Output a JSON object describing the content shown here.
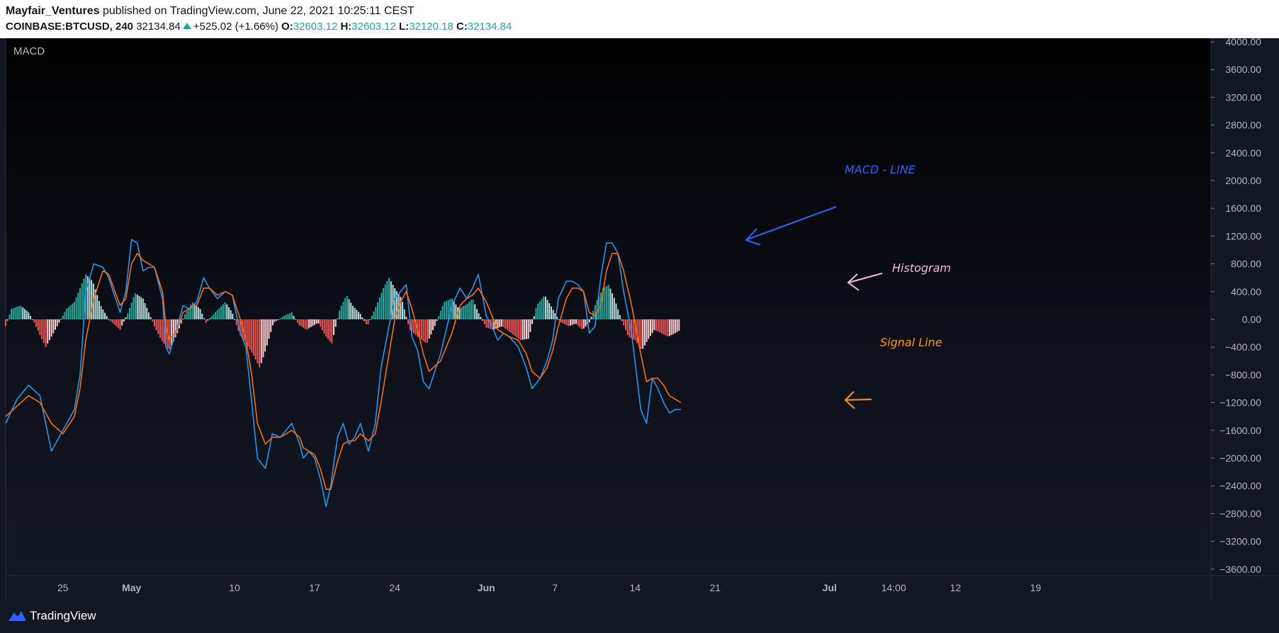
{
  "header": {
    "author": "Mayfair_Ventures",
    "published_text": " published on TradingView.com, June 22, 2021 10:25:11 CEST",
    "symbol": "COINBASE:BTCUSD, 240",
    "last": "32134.84",
    "change": "+525.02 (+1.66%)",
    "o_label": "O:",
    "o_value": "32603.12",
    "h_label": "H:",
    "h_value": "32603.12",
    "l_label": "L:",
    "l_value": "32120.18",
    "c_label": "C:",
    "c_value": "32134.84"
  },
  "footer": {
    "brand": "TradingView"
  },
  "colors": {
    "background": "#131722",
    "macd_line": "#2196f3",
    "signal_line": "#ff6d00",
    "hist_up_strong": "#26a69a",
    "hist_up_weak": "#b2dfdb",
    "hist_down_strong": "#ef5350",
    "hist_down_weak": "#ffcdd2",
    "annotation_macd": "#2962ff",
    "annotation_histogram": "#f8bbd0",
    "annotation_signal": "#ff9800"
  },
  "chart_data": {
    "type": "line",
    "title": "MACD",
    "ylim": [
      -3600,
      4000
    ],
    "y_ticks": [
      4000,
      3600,
      3200,
      2800,
      2400,
      2000,
      1600,
      1200,
      800,
      400,
      0,
      -400,
      -800,
      -1200,
      -1600,
      -2000,
      -2400,
      -2800,
      -3200,
      -3600
    ],
    "y_tick_labels": [
      "4000.00",
      "3600.00",
      "3200.00",
      "2800.00",
      "2400.00",
      "2000.00",
      "1600.00",
      "1200.00",
      "800.00",
      "400.00",
      "0.00",
      "−400.00",
      "−800.00",
      "−1200.00",
      "−1600.00",
      "−2000.00",
      "−2400.00",
      "−2800.00",
      "−3200.00",
      "−3600.00"
    ],
    "x_ticks": [
      {
        "day": 25,
        "label": "25"
      },
      {
        "day": 31,
        "label": "May"
      },
      {
        "day": 40,
        "label": "10"
      },
      {
        "day": 47,
        "label": "17"
      },
      {
        "day": 54,
        "label": "24"
      },
      {
        "day": 62,
        "label": "Jun"
      },
      {
        "day": 68,
        "label": "7"
      },
      {
        "day": 75,
        "label": "14"
      },
      {
        "day": 82,
        "label": "21"
      },
      {
        "day": 92,
        "label": "Jul"
      },
      {
        "day": 97.6,
        "label": "14:00"
      },
      {
        "day": 103,
        "label": "12"
      },
      {
        "day": 110,
        "label": "19"
      }
    ],
    "x_range": [
      20,
      113
    ],
    "grid": false,
    "series": [
      {
        "name": "MACD - LINE",
        "points": [
          [
            20,
            -1500
          ],
          [
            21,
            -1150
          ],
          [
            22,
            -950
          ],
          [
            23,
            -1100
          ],
          [
            24,
            -1900
          ],
          [
            25,
            -1600
          ],
          [
            26,
            -1300
          ],
          [
            26.5,
            -800
          ],
          [
            27,
            400
          ],
          [
            27.7,
            800
          ],
          [
            28.5,
            750
          ],
          [
            29,
            600
          ],
          [
            30,
            100
          ],
          [
            30.5,
            400
          ],
          [
            31,
            1150
          ],
          [
            31.5,
            1100
          ],
          [
            32,
            700
          ],
          [
            32.5,
            750
          ],
          [
            33,
            750
          ],
          [
            33.7,
            300
          ],
          [
            34,
            -400
          ],
          [
            34.3,
            -500
          ],
          [
            35,
            -100
          ],
          [
            35.5,
            200
          ],
          [
            36,
            150
          ],
          [
            36.7,
            250
          ],
          [
            37.3,
            600
          ],
          [
            37.8,
            450
          ],
          [
            38.5,
            300
          ],
          [
            39.2,
            400
          ],
          [
            39.8,
            350
          ],
          [
            40.5,
            -200
          ],
          [
            41,
            -400
          ],
          [
            41.5,
            -1200
          ],
          [
            42,
            -2000
          ],
          [
            42.7,
            -2150
          ],
          [
            43.3,
            -1650
          ],
          [
            44,
            -1700
          ],
          [
            45,
            -1500
          ],
          [
            45.7,
            -1800
          ],
          [
            46,
            -2000
          ],
          [
            46.5,
            -1900
          ],
          [
            47,
            -2000
          ],
          [
            47.5,
            -2300
          ],
          [
            48,
            -2700
          ],
          [
            48.4,
            -2400
          ],
          [
            49,
            -1700
          ],
          [
            49.5,
            -1500
          ],
          [
            50,
            -1800
          ],
          [
            50.5,
            -1700
          ],
          [
            51,
            -1500
          ],
          [
            51.7,
            -1900
          ],
          [
            52.3,
            -1500
          ],
          [
            52.8,
            -700
          ],
          [
            53.5,
            -100
          ],
          [
            54,
            300
          ],
          [
            54.5,
            400
          ],
          [
            55,
            500
          ],
          [
            55.5,
            -250
          ],
          [
            56,
            -450
          ],
          [
            56.5,
            -900
          ],
          [
            57,
            -1000
          ],
          [
            58,
            -500
          ],
          [
            59,
            200
          ],
          [
            59.7,
            450
          ],
          [
            60.3,
            300
          ],
          [
            60.8,
            450
          ],
          [
            61.3,
            650
          ],
          [
            62,
            50
          ],
          [
            62.5,
            -100
          ],
          [
            63,
            -300
          ],
          [
            63.5,
            -200
          ],
          [
            64,
            -250
          ],
          [
            64.8,
            -400
          ],
          [
            65.5,
            -700
          ],
          [
            66,
            -1000
          ],
          [
            66.7,
            -850
          ],
          [
            67.3,
            -600
          ],
          [
            67.8,
            -300
          ],
          [
            68.3,
            300
          ],
          [
            69,
            550
          ],
          [
            69.5,
            550
          ],
          [
            70,
            500
          ],
          [
            70.5,
            400
          ],
          [
            71,
            -200
          ],
          [
            71.5,
            -100
          ],
          [
            72,
            600
          ],
          [
            72.5,
            1100
          ],
          [
            73,
            1100
          ],
          [
            73.5,
            950
          ],
          [
            74,
            400
          ],
          [
            74.7,
            -200
          ],
          [
            75.5,
            -1300
          ],
          [
            76,
            -1500
          ],
          [
            76.5,
            -850
          ],
          [
            77,
            -1000
          ],
          [
            77.5,
            -1200
          ],
          [
            78,
            -1350
          ],
          [
            78.5,
            -1300
          ],
          [
            79,
            -1300
          ]
        ]
      },
      {
        "name": "Signal Line",
        "points": [
          [
            20,
            -1400
          ],
          [
            21,
            -1250
          ],
          [
            22,
            -1100
          ],
          [
            23,
            -1200
          ],
          [
            24,
            -1500
          ],
          [
            25,
            -1650
          ],
          [
            26,
            -1400
          ],
          [
            26.5,
            -1000
          ],
          [
            27,
            -300
          ],
          [
            27.7,
            300
          ],
          [
            28.5,
            700
          ],
          [
            29,
            650
          ],
          [
            30,
            200
          ],
          [
            30.5,
            300
          ],
          [
            31,
            800
          ],
          [
            31.5,
            950
          ],
          [
            32,
            850
          ],
          [
            32.5,
            800
          ],
          [
            33,
            750
          ],
          [
            33.7,
            400
          ],
          [
            34,
            -100
          ],
          [
            34.3,
            -300
          ],
          [
            35,
            -150
          ],
          [
            35.5,
            100
          ],
          [
            36,
            150
          ],
          [
            36.7,
            200
          ],
          [
            37.3,
            450
          ],
          [
            37.8,
            450
          ],
          [
            38.5,
            350
          ],
          [
            39.2,
            400
          ],
          [
            39.8,
            350
          ],
          [
            40.5,
            0
          ],
          [
            41,
            -300
          ],
          [
            41.5,
            -800
          ],
          [
            42,
            -1500
          ],
          [
            42.7,
            -1800
          ],
          [
            43.3,
            -1700
          ],
          [
            44,
            -1700
          ],
          [
            45,
            -1600
          ],
          [
            45.7,
            -1700
          ],
          [
            46,
            -1850
          ],
          [
            46.5,
            -1900
          ],
          [
            47,
            -1950
          ],
          [
            47.5,
            -2150
          ],
          [
            48,
            -2450
          ],
          [
            48.4,
            -2450
          ],
          [
            49,
            -2050
          ],
          [
            49.5,
            -1800
          ],
          [
            50,
            -1750
          ],
          [
            50.5,
            -1750
          ],
          [
            51,
            -1650
          ],
          [
            51.7,
            -1750
          ],
          [
            52.3,
            -1650
          ],
          [
            52.8,
            -1200
          ],
          [
            53.5,
            -500
          ],
          [
            54,
            0
          ],
          [
            54.5,
            250
          ],
          [
            55,
            400
          ],
          [
            55.5,
            150
          ],
          [
            56,
            -150
          ],
          [
            56.5,
            -500
          ],
          [
            57,
            -750
          ],
          [
            58,
            -600
          ],
          [
            59,
            -200
          ],
          [
            59.7,
            200
          ],
          [
            60.3,
            300
          ],
          [
            60.8,
            350
          ],
          [
            61.3,
            450
          ],
          [
            62,
            250
          ],
          [
            62.5,
            50
          ],
          [
            63,
            -150
          ],
          [
            63.5,
            -200
          ],
          [
            64,
            -250
          ],
          [
            64.8,
            -300
          ],
          [
            65.5,
            -500
          ],
          [
            66,
            -750
          ],
          [
            66.7,
            -850
          ],
          [
            67.3,
            -700
          ],
          [
            67.8,
            -450
          ],
          [
            68.3,
            -100
          ],
          [
            69,
            300
          ],
          [
            69.5,
            450
          ],
          [
            70,
            450
          ],
          [
            70.5,
            400
          ],
          [
            71,
            100
          ],
          [
            71.5,
            50
          ],
          [
            72,
            200
          ],
          [
            72.5,
            700
          ],
          [
            73,
            950
          ],
          [
            73.5,
            950
          ],
          [
            74,
            700
          ],
          [
            74.7,
            200
          ],
          [
            75.5,
            -500
          ],
          [
            76,
            -900
          ],
          [
            76.5,
            -850
          ],
          [
            77,
            -850
          ],
          [
            77.5,
            -950
          ],
          [
            78,
            -1100
          ],
          [
            78.5,
            -1150
          ],
          [
            79,
            -1200
          ]
        ]
      }
    ],
    "histogram_anchors": [
      [
        20,
        -100
      ],
      [
        20.5,
        150
      ],
      [
        21.3,
        200
      ],
      [
        22,
        100
      ],
      [
        22.5,
        -50
      ],
      [
        23.5,
        -400
      ],
      [
        24.5,
        -100
      ],
      [
        25.3,
        150
      ],
      [
        26,
        250
      ],
      [
        27,
        650
      ],
      [
        27.6,
        550
      ],
      [
        28.3,
        200
      ],
      [
        29,
        0
      ],
      [
        30,
        -150
      ],
      [
        30.7,
        100
      ],
      [
        31.3,
        380
      ],
      [
        32,
        300
      ],
      [
        32.5,
        100
      ],
      [
        33,
        -100
      ],
      [
        33.6,
        -300
      ],
      [
        34.3,
        -450
      ],
      [
        35,
        -200
      ],
      [
        35.6,
        50
      ],
      [
        36.3,
        250
      ],
      [
        37,
        150
      ],
      [
        37.5,
        -50
      ],
      [
        38.3,
        100
      ],
      [
        39.2,
        250
      ],
      [
        39.8,
        100
      ],
      [
        40.4,
        -200
      ],
      [
        41,
        -350
      ],
      [
        41.6,
        -500
      ],
      [
        42.2,
        -700
      ],
      [
        42.8,
        -400
      ],
      [
        43.4,
        -50
      ],
      [
        44.3,
        50
      ],
      [
        45,
        100
      ],
      [
        45.6,
        -80
      ],
      [
        46.3,
        -150
      ],
      [
        47.3,
        -50
      ],
      [
        48,
        -250
      ],
      [
        48.5,
        -350
      ],
      [
        49.2,
        150
      ],
      [
        49.8,
        350
      ],
      [
        50.3,
        200
      ],
      [
        51,
        80
      ],
      [
        51.6,
        -100
      ],
      [
        52.4,
        200
      ],
      [
        53,
        450
      ],
      [
        53.5,
        600
      ],
      [
        54,
        450
      ],
      [
        54.6,
        300
      ],
      [
        55.3,
        -150
      ],
      [
        56,
        -250
      ],
      [
        56.8,
        -350
      ],
      [
        57.5,
        -100
      ],
      [
        58.3,
        250
      ],
      [
        59,
        300
      ],
      [
        59.6,
        150
      ],
      [
        60.3,
        220
      ],
      [
        60.8,
        300
      ],
      [
        61.3,
        100
      ],
      [
        62,
        -120
      ],
      [
        62.6,
        -150
      ],
      [
        63.4,
        -100
      ],
      [
        64.2,
        -200
      ],
      [
        65,
        -300
      ],
      [
        65.7,
        -280
      ],
      [
        66.4,
        200
      ],
      [
        67.1,
        350
      ],
      [
        67.8,
        150
      ],
      [
        68.4,
        -30
      ],
      [
        69.2,
        -100
      ],
      [
        69.8,
        -60
      ],
      [
        70.4,
        -150
      ],
      [
        71,
        -50
      ],
      [
        71.6,
        250
      ],
      [
        72.2,
        450
      ],
      [
        72.7,
        500
      ],
      [
        73.2,
        300
      ],
      [
        73.8,
        0
      ],
      [
        74.4,
        -250
      ],
      [
        75,
        -300
      ],
      [
        75.6,
        -450
      ],
      [
        76.1,
        -300
      ],
      [
        76.7,
        -150
      ],
      [
        77.3,
        -200
      ],
      [
        77.9,
        -250
      ],
      [
        78.5,
        -200
      ],
      [
        79,
        -150
      ]
    ],
    "annotations": [
      {
        "label": "MACD - LINE",
        "color_key": "annotation_macd"
      },
      {
        "label": "Histogram",
        "color_key": "annotation_histogram"
      },
      {
        "label": "Signal Line",
        "color_key": "annotation_signal"
      }
    ]
  }
}
